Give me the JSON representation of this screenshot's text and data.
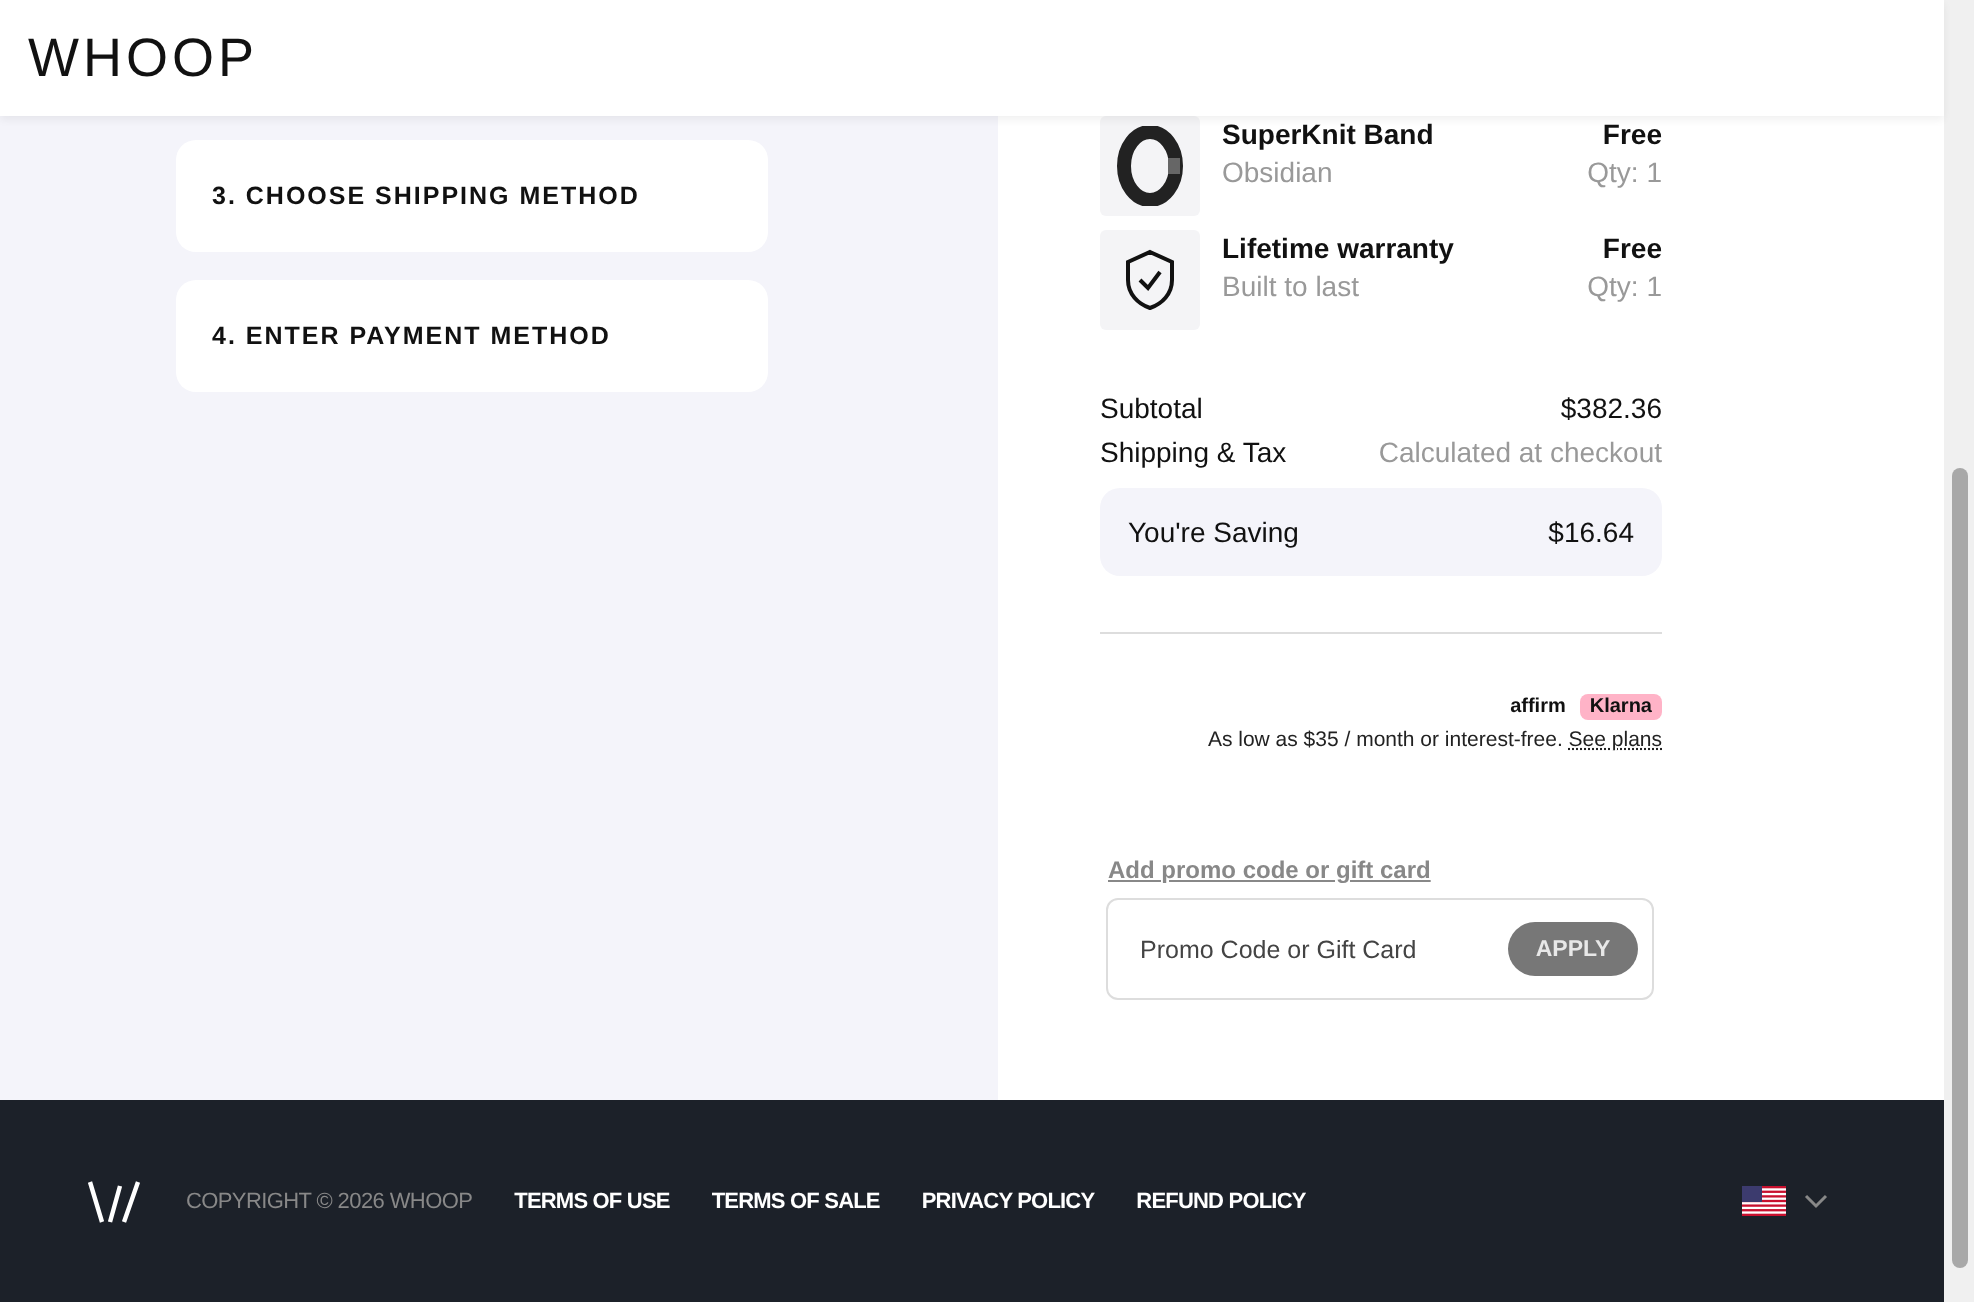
{
  "header": {
    "logo": "WHOOP"
  },
  "steps": [
    {
      "label": "3. CHOOSE SHIPPING METHOD"
    },
    {
      "label": "4. ENTER PAYMENT METHOD"
    }
  ],
  "items": [
    {
      "kind": "band",
      "name": "SuperKnit Band",
      "variant": "Obsidian",
      "price": "Free",
      "qty": "Qty: 1"
    },
    {
      "kind": "warranty",
      "name": "Lifetime warranty",
      "variant": "Built to last",
      "price": "Free",
      "qty": "Qty: 1"
    }
  ],
  "totals": [
    {
      "label": "Subtotal",
      "value": "$382.36",
      "muted": false
    },
    {
      "label": "Shipping & Tax",
      "value": "Calculated at checkout",
      "muted": true
    }
  ],
  "saving": {
    "label": "You're Saving",
    "value": "$16.64"
  },
  "financing": {
    "affirm": "affirm",
    "klarna": "Klarna",
    "text": "As low as $35 / month or interest-free.",
    "link": "See plans"
  },
  "promo": {
    "link": "Add promo code or gift card",
    "placeholder": "Promo Code or Gift Card",
    "button": "APPLY"
  },
  "footer": {
    "copyright": "COPYRIGHT © 2026 WHOOP",
    "links": [
      "TERMS OF USE",
      "TERMS OF SALE",
      "PRIVACY POLICY",
      "REFUND POLICY"
    ]
  }
}
